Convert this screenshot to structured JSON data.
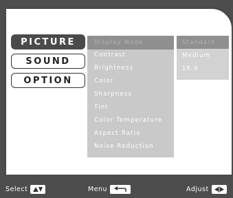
{
  "tabs": [
    {
      "label": "PICTURE",
      "active": true
    },
    {
      "label": "SOUND",
      "active": false
    },
    {
      "label": "OPTION",
      "active": false
    }
  ],
  "menu_items": [
    {
      "label": "Display Mode",
      "selected": true
    },
    {
      "label": "Contrast",
      "selected": false
    },
    {
      "label": "Brightness",
      "selected": false
    },
    {
      "label": "Color",
      "selected": false
    },
    {
      "label": "Sharpness",
      "selected": false
    },
    {
      "label": "Tint",
      "selected": false
    },
    {
      "label": "Color Temperature",
      "selected": false
    },
    {
      "label": "Aspect Ratio",
      "selected": false
    },
    {
      "label": "Noise Reduction",
      "selected": false
    }
  ],
  "values": [
    {
      "label": "Standard",
      "selected": true
    },
    {
      "label": "Medium",
      "selected": false
    },
    {
      "label": "16:9",
      "selected": false
    }
  ],
  "footer": {
    "select_label": "Select",
    "menu_label": "Menu",
    "adjust_label": "Adjust"
  },
  "colors": {
    "frame": "#4d4d4d",
    "active_tab": "#4a4a4a",
    "menu_bg": "#c9c9c9",
    "highlight": "#8f8f8f"
  },
  "icons": {
    "select": "up-down-arrows-icon",
    "menu": "return-arrow-icon",
    "adjust": "left-right-arrows-icon"
  }
}
